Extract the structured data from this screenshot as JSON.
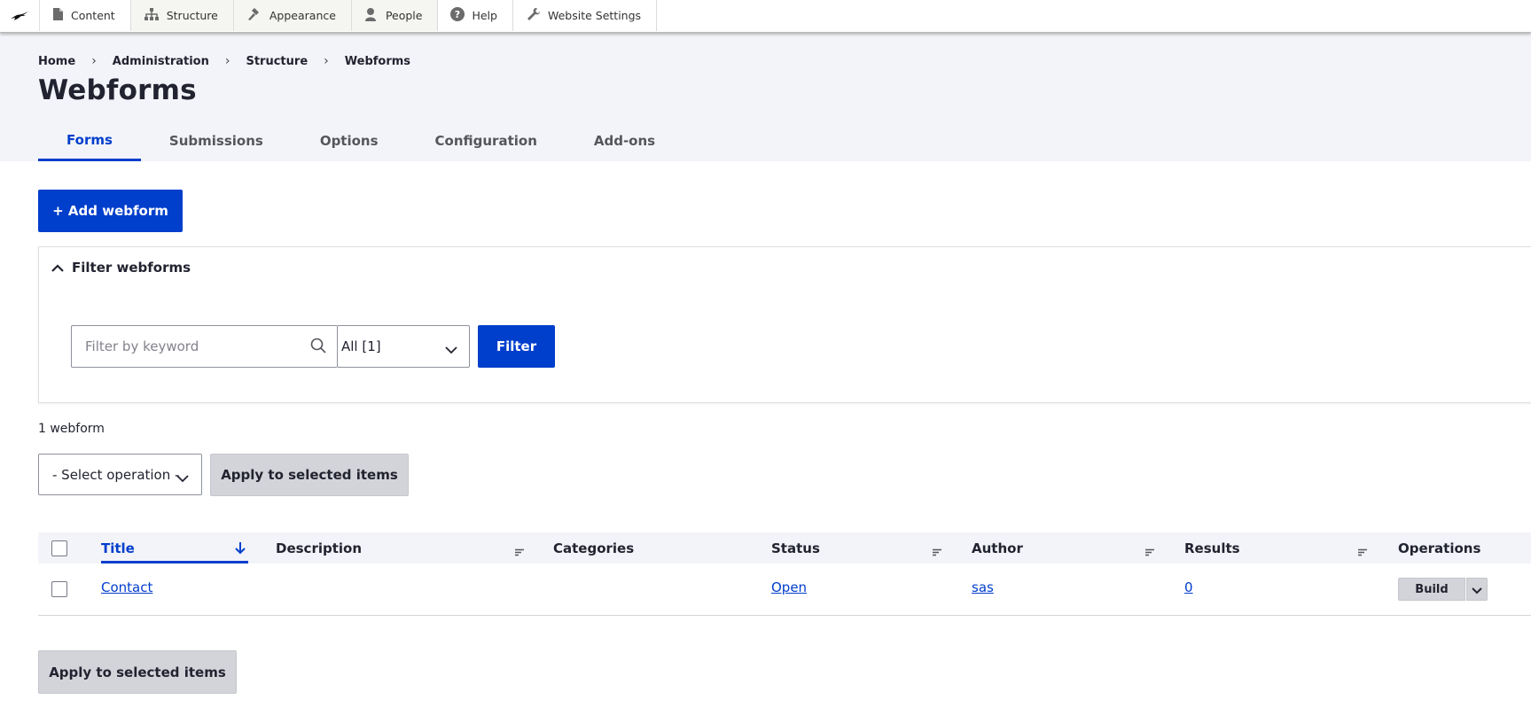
{
  "toolbar": {
    "items": [
      {
        "label": "Content",
        "icon": "content-icon"
      },
      {
        "label": "Structure",
        "icon": "structure-icon"
      },
      {
        "label": "Appearance",
        "icon": "appearance-icon"
      },
      {
        "label": "People",
        "icon": "people-icon"
      },
      {
        "label": "Help",
        "icon": "help-icon"
      },
      {
        "label": "Website Settings",
        "icon": "wrench-icon"
      }
    ]
  },
  "breadcrumb": [
    "Home",
    "Administration",
    "Structure",
    "Webforms"
  ],
  "page_title": "Webforms",
  "tabs": [
    {
      "label": "Forms",
      "active": true
    },
    {
      "label": "Submissions"
    },
    {
      "label": "Options"
    },
    {
      "label": "Configuration"
    },
    {
      "label": "Add-ons"
    }
  ],
  "add_button": "+ Add webform",
  "filter": {
    "summary": "Filter webforms",
    "keyword_placeholder": "Filter by keyword",
    "category_value": "All [1]",
    "submit": "Filter"
  },
  "count": "1 webform",
  "bulk": {
    "select_value": "- Select operation -",
    "apply": "Apply to selected items"
  },
  "table": {
    "headers": [
      "Title",
      "Description",
      "Categories",
      "Status",
      "Author",
      "Results",
      "Operations"
    ],
    "rows": [
      {
        "title": "Contact",
        "description": "",
        "categories": "",
        "status": "Open",
        "author": "sas",
        "results": "0",
        "operation": "Build"
      }
    ]
  },
  "bottom_apply": "Apply to selected items",
  "colors": {
    "accent": "#003ecc",
    "header_bg": "#f3f4f9",
    "secondary_button": "#d3d4d9"
  }
}
